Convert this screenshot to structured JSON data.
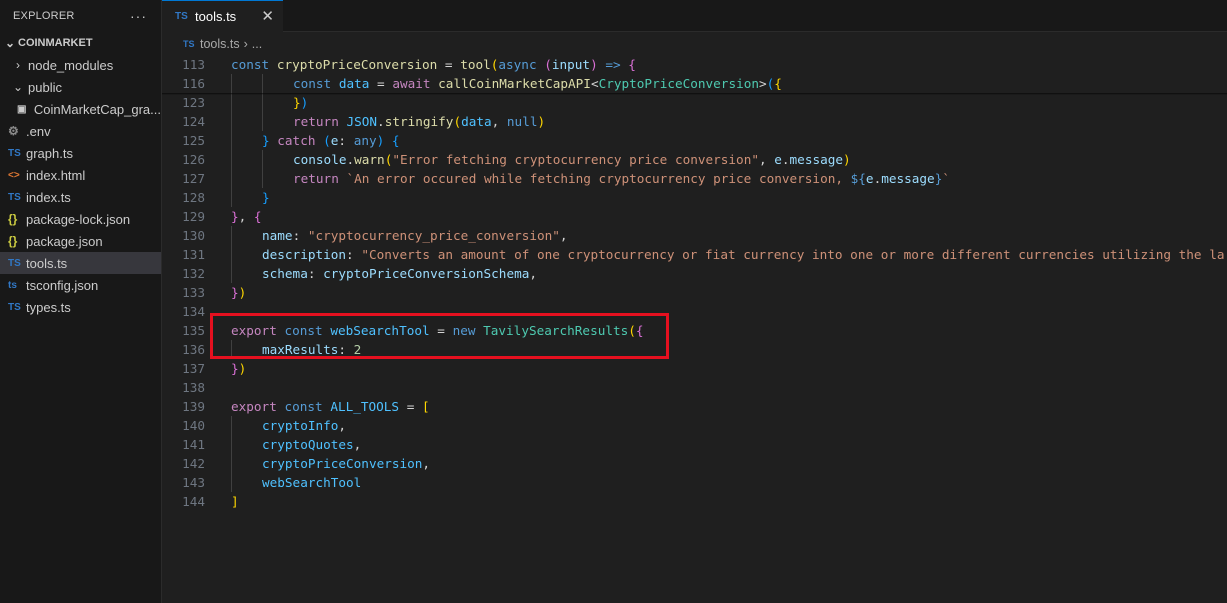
{
  "sidebar": {
    "title": "EXPLORER",
    "more_glyph": "···",
    "project": "COINMARKET",
    "items": [
      {
        "label": "node_modules",
        "kind": "folder",
        "chevron": "›",
        "indent": 10
      },
      {
        "label": "public",
        "kind": "folder",
        "chevron": "⌄",
        "indent": 10
      },
      {
        "label": "CoinMarketCap_gra...",
        "kind": "image",
        "icon": "▣",
        "indent": 17
      },
      {
        "label": ".env",
        "kind": "env",
        "icon": "⚙",
        "indent": 8
      },
      {
        "label": "graph.ts",
        "kind": "ts",
        "icon": "TS",
        "indent": 8
      },
      {
        "label": "index.html",
        "kind": "html",
        "icon": "<>",
        "indent": 8
      },
      {
        "label": "index.ts",
        "kind": "ts",
        "icon": "TS",
        "indent": 8
      },
      {
        "label": "package-lock.json",
        "kind": "json",
        "icon": "{}",
        "indent": 8
      },
      {
        "label": "package.json",
        "kind": "json",
        "icon": "{}",
        "indent": 8
      },
      {
        "label": "tools.ts",
        "kind": "ts",
        "icon": "TS",
        "indent": 8,
        "selected": true
      },
      {
        "label": "tsconfig.json",
        "kind": "tsconfig",
        "icon": "ts",
        "indent": 8
      },
      {
        "label": "types.ts",
        "kind": "ts",
        "icon": "TS",
        "indent": 8
      }
    ]
  },
  "tab": {
    "icon": "TS",
    "label": "tools.ts",
    "close": "✕"
  },
  "breadcrumb": {
    "icon": "TS",
    "file": "tools.ts",
    "sep": "›",
    "rest": "..."
  },
  "editor": {
    "lines": [
      {
        "n": "113",
        "indent": 0,
        "tokens": [
          [
            "k",
            "const "
          ],
          [
            "f",
            "cryptoPriceConversion"
          ],
          [
            "p",
            " = "
          ],
          [
            "f",
            "tool"
          ],
          [
            "b1",
            "("
          ],
          [
            "k",
            "async "
          ],
          [
            "b2",
            "("
          ],
          [
            "v",
            "input"
          ],
          [
            "b2",
            ")"
          ],
          [
            "k",
            " => "
          ],
          [
            "b2",
            "{"
          ]
        ]
      },
      {
        "n": "116",
        "indent": 2,
        "tokens": [
          [
            "k",
            "const "
          ],
          [
            "cn",
            "data"
          ],
          [
            "p",
            " = "
          ],
          [
            "c",
            "await "
          ],
          [
            "f",
            "callCoinMarketCapAPI"
          ],
          [
            "p",
            "<"
          ],
          [
            "t",
            "CryptoPriceConversion"
          ],
          [
            "p",
            ">"
          ],
          [
            "b3",
            "("
          ],
          [
            "b1",
            "{"
          ]
        ]
      },
      {
        "n": "123",
        "indent": 2,
        "tokens": [
          [
            "b1",
            "}"
          ],
          [
            "b3",
            ")"
          ]
        ]
      },
      {
        "n": "124",
        "indent": 2,
        "tokens": [
          [
            "c",
            "return "
          ],
          [
            "cn",
            "JSON"
          ],
          [
            "p",
            "."
          ],
          [
            "f",
            "stringify"
          ],
          [
            "b1",
            "("
          ],
          [
            "cn",
            "data"
          ],
          [
            "p",
            ", "
          ],
          [
            "k",
            "null"
          ],
          [
            "b1",
            ")"
          ]
        ]
      },
      {
        "n": "125",
        "indent": 1,
        "tokens": [
          [
            "b3",
            "}"
          ],
          [
            "c",
            " catch "
          ],
          [
            "b3",
            "("
          ],
          [
            "v",
            "e"
          ],
          [
            "p",
            ": "
          ],
          [
            "k",
            "any"
          ],
          [
            "b3",
            ")"
          ],
          [
            "p",
            " "
          ],
          [
            "b3",
            "{"
          ]
        ]
      },
      {
        "n": "126",
        "indent": 2,
        "tokens": [
          [
            "v",
            "console"
          ],
          [
            "p",
            "."
          ],
          [
            "f",
            "warn"
          ],
          [
            "b1",
            "("
          ],
          [
            "s",
            "\"Error fetching cryptocurrency price conversion\""
          ],
          [
            "p",
            ", "
          ],
          [
            "v",
            "e"
          ],
          [
            "p",
            "."
          ],
          [
            "v",
            "message"
          ],
          [
            "b1",
            ")"
          ]
        ]
      },
      {
        "n": "127",
        "indent": 2,
        "tokens": [
          [
            "c",
            "return "
          ],
          [
            "s",
            "`An error occured while fetching cryptocurrency price conversion, "
          ],
          [
            "k",
            "${"
          ],
          [
            "v",
            "e"
          ],
          [
            "p",
            "."
          ],
          [
            "v",
            "message"
          ],
          [
            "k",
            "}"
          ],
          [
            "s",
            "`"
          ]
        ]
      },
      {
        "n": "128",
        "indent": 1,
        "tokens": [
          [
            "b3",
            "}"
          ]
        ]
      },
      {
        "n": "129",
        "indent": 0,
        "tokens": [
          [
            "b2",
            "}"
          ],
          [
            "p",
            ", "
          ],
          [
            "b2",
            "{"
          ]
        ]
      },
      {
        "n": "130",
        "indent": 1,
        "tokens": [
          [
            "v",
            "name"
          ],
          [
            "p",
            ": "
          ],
          [
            "s",
            "\"cryptocurrency_price_conversion\""
          ],
          [
            "p",
            ","
          ]
        ]
      },
      {
        "n": "131",
        "indent": 1,
        "tokens": [
          [
            "v",
            "description"
          ],
          [
            "p",
            ": "
          ],
          [
            "s",
            "\"Converts an amount of one cryptocurrency or fiat currency into one or more different currencies utilizing the la"
          ]
        ]
      },
      {
        "n": "132",
        "indent": 1,
        "tokens": [
          [
            "v",
            "schema"
          ],
          [
            "p",
            ": "
          ],
          [
            "v",
            "cryptoPriceConversionSchema"
          ],
          [
            "p",
            ","
          ]
        ]
      },
      {
        "n": "133",
        "indent": 0,
        "tokens": [
          [
            "b2",
            "}"
          ],
          [
            "b1",
            ")"
          ]
        ]
      },
      {
        "n": "134",
        "indent": 0,
        "tokens": []
      },
      {
        "n": "135",
        "indent": 0,
        "tokens": [
          [
            "c",
            "export "
          ],
          [
            "k",
            "const "
          ],
          [
            "cn",
            "webSearchTool"
          ],
          [
            "p",
            " = "
          ],
          [
            "k",
            "new "
          ],
          [
            "t",
            "TavilySearchResults"
          ],
          [
            "b1",
            "("
          ],
          [
            "b2",
            "{"
          ]
        ]
      },
      {
        "n": "136",
        "indent": 1,
        "tokens": [
          [
            "v",
            "maxResults"
          ],
          [
            "p",
            ": "
          ],
          [
            "n",
            "2"
          ]
        ]
      },
      {
        "n": "137",
        "indent": 0,
        "tokens": [
          [
            "b2",
            "}"
          ],
          [
            "b1",
            ")"
          ]
        ]
      },
      {
        "n": "138",
        "indent": 0,
        "tokens": []
      },
      {
        "n": "139",
        "indent": 0,
        "tokens": [
          [
            "c",
            "export "
          ],
          [
            "k",
            "const "
          ],
          [
            "cn",
            "ALL_TOOLS"
          ],
          [
            "p",
            " = "
          ],
          [
            "b1",
            "["
          ]
        ]
      },
      {
        "n": "140",
        "indent": 1,
        "tokens": [
          [
            "cn",
            "cryptoInfo"
          ],
          [
            "p",
            ","
          ]
        ]
      },
      {
        "n": "141",
        "indent": 1,
        "tokens": [
          [
            "cn",
            "cryptoQuotes"
          ],
          [
            "p",
            ","
          ]
        ]
      },
      {
        "n": "142",
        "indent": 1,
        "tokens": [
          [
            "cn",
            "cryptoPriceConversion"
          ],
          [
            "p",
            ","
          ]
        ]
      },
      {
        "n": "143",
        "indent": 1,
        "tokens": [
          [
            "cn",
            "webSearchTool"
          ]
        ]
      },
      {
        "n": "144",
        "indent": 0,
        "tokens": [
          [
            "b1",
            "]"
          ]
        ]
      }
    ]
  },
  "annotation": {
    "color": "#e5101f"
  }
}
